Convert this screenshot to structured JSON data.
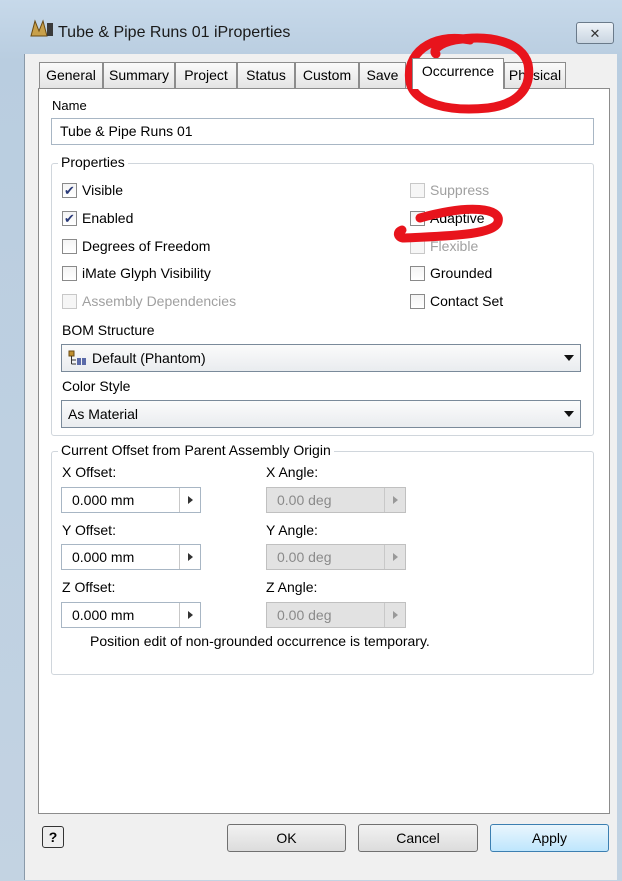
{
  "window": {
    "title": "Tube & Pipe Runs 01 iProperties",
    "close_label": "✕"
  },
  "tabs": [
    "General",
    "Summary",
    "Project",
    "Status",
    "Custom",
    "Save",
    "Occurrence",
    "Physical"
  ],
  "active_tab": "Occurrence",
  "name_section": {
    "label": "Name",
    "value": "Tube & Pipe Runs 01"
  },
  "properties": {
    "title": "Properties",
    "left": [
      {
        "label": "Visible",
        "checked": true,
        "disabled": false
      },
      {
        "label": "Enabled",
        "checked": true,
        "disabled": false
      },
      {
        "label": "Degrees of Freedom",
        "checked": false,
        "disabled": false
      },
      {
        "label": "iMate Glyph Visibility",
        "checked": false,
        "disabled": false
      },
      {
        "label": "Assembly Dependencies",
        "checked": false,
        "disabled": true
      }
    ],
    "right": [
      {
        "label": "Suppress",
        "checked": false,
        "disabled": true
      },
      {
        "label": "Adaptive",
        "checked": false,
        "disabled": false
      },
      {
        "label": "Flexible",
        "checked": false,
        "disabled": true
      },
      {
        "label": "Grounded",
        "checked": false,
        "disabled": false
      },
      {
        "label": "Contact Set",
        "checked": false,
        "disabled": false
      }
    ],
    "bom_label": "BOM Structure",
    "bom_value": "Default (Phantom)",
    "color_label": "Color Style",
    "color_value": "As Material"
  },
  "offset": {
    "title": "Current Offset from Parent Assembly Origin",
    "x_label": "X Offset:",
    "x_value": "0.000 mm",
    "y_label": "Y Offset:",
    "y_value": "0.000 mm",
    "z_label": "Z Offset:",
    "z_value": "0.000 mm",
    "xa_label": "X Angle:",
    "xa_value": "0.00 deg",
    "ya_label": "Y Angle:",
    "ya_value": "0.00 deg",
    "za_label": "Z Angle:",
    "za_value": "0.00 deg",
    "note": "Position edit of non-grounded occurrence is temporary."
  },
  "buttons": {
    "help": "?",
    "ok": "OK",
    "cancel": "Cancel",
    "apply": "Apply"
  },
  "colors": {
    "annotation": "#e8141c",
    "window_frame": "#c3d3e2",
    "check": "#2a3a78"
  }
}
